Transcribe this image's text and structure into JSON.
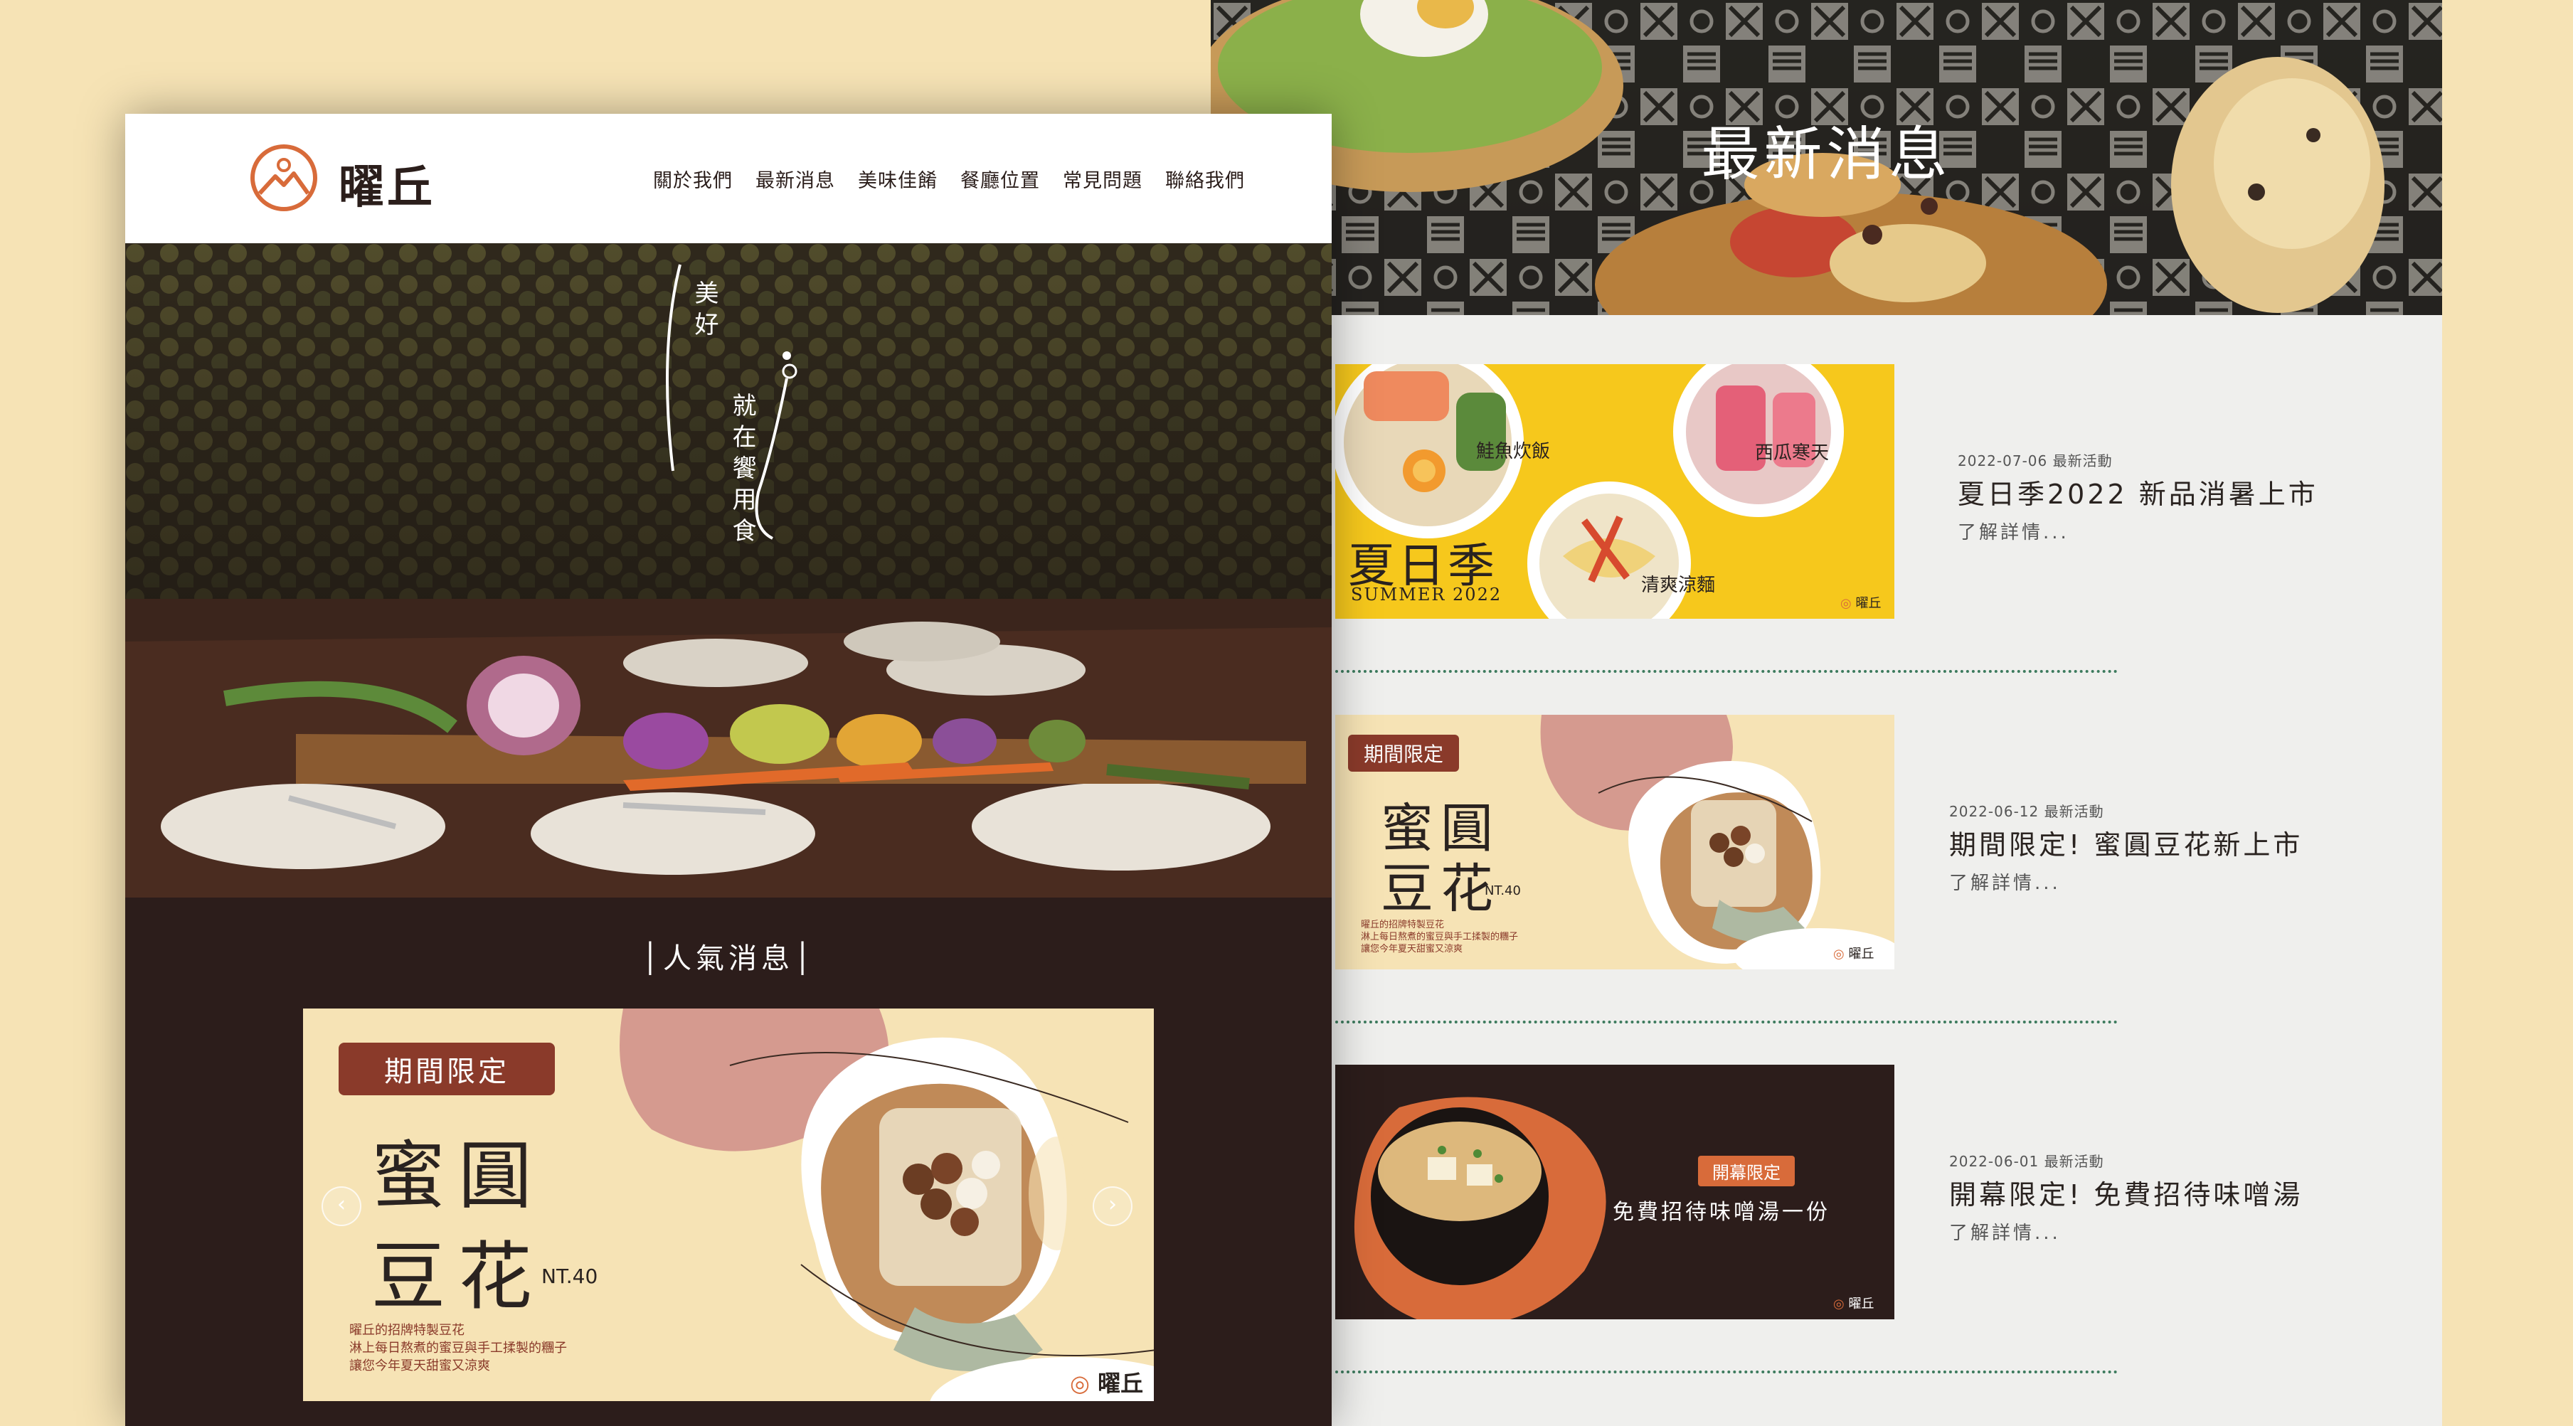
{
  "colors": {
    "page_background": "#f6e3b5",
    "brand_dark": "#2c1d1b",
    "brand_orange": "#d86b3a",
    "accent_rose": "#d59a8f",
    "accent_green": "#3d7b5e",
    "summer_yellow": "#f6c81c"
  },
  "home": {
    "brand": {
      "name": "曜丘",
      "logo_icon": "mountain-sun-logo-icon"
    },
    "nav": [
      "關於我們",
      "最新消息",
      "美味佳餚",
      "餐廳位置",
      "常見問題",
      "聯絡我們"
    ],
    "hero": {
      "tagline_a": "美好",
      "tagline_b": "就在饗用食"
    },
    "popular_heading": "│人氣消息│",
    "carousel": {
      "badge": "期間限定",
      "title_line1": "蜜圓",
      "title_line2": "豆花",
      "price": "NT.40",
      "desc1": "曜丘的招牌特製豆花",
      "desc2": "淋上每日熬煮的蜜豆與手工揉製的糰子",
      "desc3": "讓您今年夏天甜蜜又涼爽",
      "logo_text": "曜丘",
      "prev_label": "‹",
      "next_label": "›"
    }
  },
  "news": {
    "hero_title": "最新消息",
    "items": [
      {
        "meta": "2022-07-06 最新活動",
        "title": "夏日季2022 新品消暑上市",
        "more": "了解詳情...",
        "thumb": {
          "title": "夏日季",
          "sub": "SUMMER 2022",
          "label1": "鮭魚炊飯",
          "label2": "西瓜寒天",
          "label3": "清爽涼麵",
          "logo_text": "曜丘"
        }
      },
      {
        "meta": "2022-06-12 最新活動",
        "title": "期間限定! 蜜圓豆花新上市",
        "more": "了解詳情...",
        "thumb": {
          "badge": "期間限定",
          "title_line1": "蜜圓",
          "title_line2": "豆花",
          "price": "NT.40",
          "desc1": "曜丘的招牌特製豆花",
          "desc2": "淋上每日熬煮的蜜豆與手工揉製的糰子",
          "desc3": "讓您今年夏天甜蜜又涼爽",
          "logo_text": "曜丘"
        }
      },
      {
        "meta": "2022-06-01 最新活動",
        "title": "開幕限定! 免費招待味噌湯",
        "more": "了解詳情...",
        "thumb": {
          "badge": "開幕限定",
          "text": "免費招待味噌湯一份",
          "logo_text": "曜丘"
        }
      }
    ]
  }
}
